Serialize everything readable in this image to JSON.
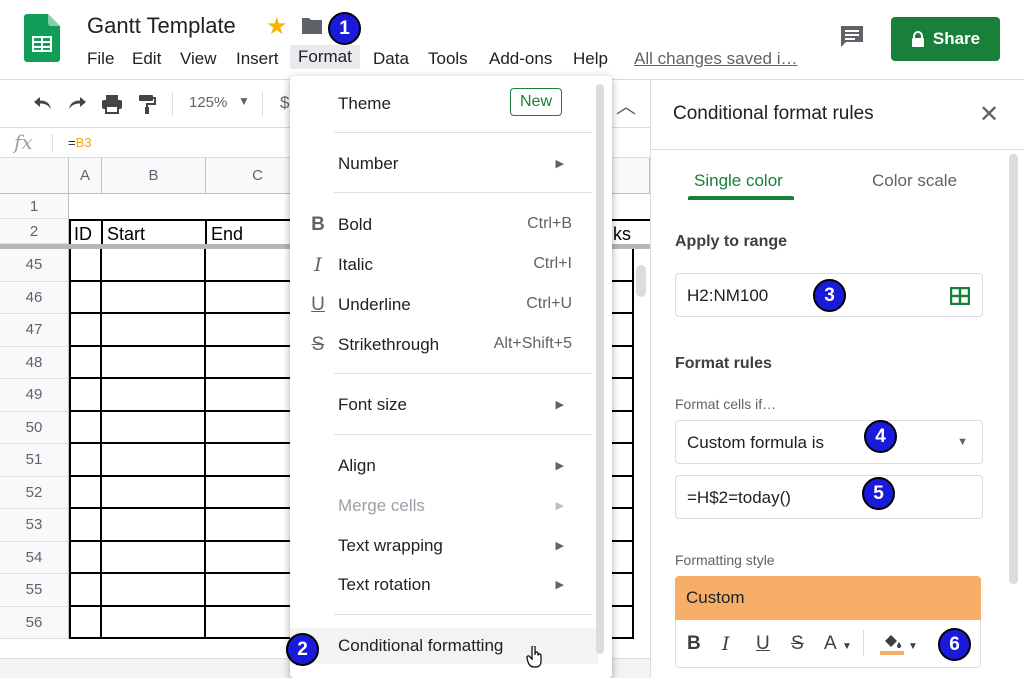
{
  "header": {
    "doc_title": "Gantt Template",
    "menus": [
      "File",
      "Edit",
      "View",
      "Insert",
      "Format",
      "Data",
      "Tools",
      "Add-ons",
      "Help"
    ],
    "active_menu": "Format",
    "saved_status": "All changes saved i…",
    "share_label": "Share",
    "icons": [
      "sheets-logo-icon",
      "star-icon",
      "folder-icon",
      "comment-icon",
      "lock-icon"
    ]
  },
  "toolbar": {
    "zoom": "125%",
    "currency": "$",
    "icons": [
      "undo-icon",
      "redo-icon",
      "print-icon",
      "paint-format-icon",
      "chevron-up-icon"
    ]
  },
  "formula_bar": {
    "fx_label": "fx",
    "prefix": "=",
    "ref": "B3"
  },
  "grid": {
    "columns": [
      "A",
      "B",
      "C"
    ],
    "top_rows": [
      "1",
      "2"
    ],
    "header_cells": [
      "ID",
      "Start",
      "End"
    ],
    "header_tail": "ks",
    "rows": [
      "45",
      "46",
      "47",
      "48",
      "49",
      "50",
      "51",
      "52",
      "53",
      "54",
      "55",
      "56"
    ]
  },
  "format_menu": {
    "theme": "Theme",
    "new_badge": "New",
    "number": "Number",
    "bold": "Bold",
    "bold_sc": "Ctrl+B",
    "italic": "Italic",
    "italic_sc": "Ctrl+I",
    "underline": "Underline",
    "underline_sc": "Ctrl+U",
    "strike": "Strikethrough",
    "strike_sc": "Alt+Shift+5",
    "font_size": "Font size",
    "align": "Align",
    "merge": "Merge cells",
    "wrapping": "Text wrapping",
    "rotation": "Text rotation",
    "conditional": "Conditional formatting"
  },
  "panel": {
    "title": "Conditional format rules",
    "tab_single": "Single color",
    "tab_scale": "Color scale",
    "apply_title": "Apply to range",
    "range_value": "H2:NM100",
    "rules_title": "Format rules",
    "cells_if_label": "Format cells if…",
    "condition_value": "Custom formula is",
    "formula_value": "=H$2=today()",
    "style_label": "Formatting style",
    "style_value": "Custom",
    "style_color": "#f6ae68"
  },
  "badges": [
    "1",
    "2",
    "3",
    "4",
    "5",
    "6"
  ],
  "colors": {
    "accent_green": "#188038",
    "badge_blue": "#1a1adb"
  }
}
